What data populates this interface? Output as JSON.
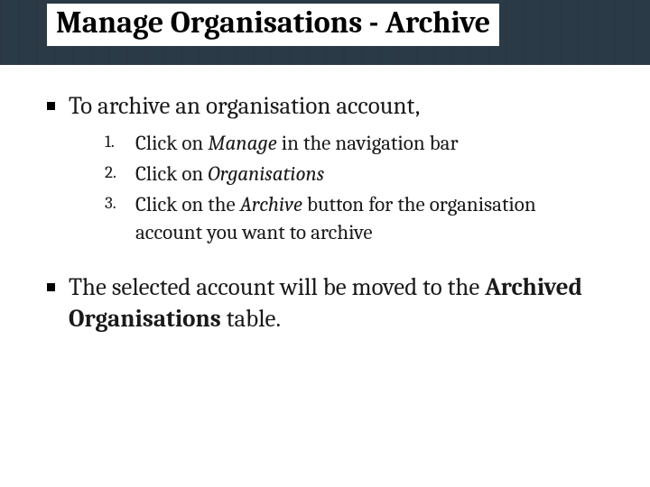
{
  "title": "Manage Organisations - Archive",
  "bullets": {
    "intro": "To archive an organisation account,",
    "steps": [
      {
        "pre": "Click on ",
        "em": "Manage",
        "post": " in the navigation bar"
      },
      {
        "pre": "Click on ",
        "em": "Organisations",
        "post": ""
      },
      {
        "pre": "Click on the ",
        "em": "Archive",
        "post": " button for the organisation account you want to archive"
      }
    ],
    "outro_pre": "The selected account will be moved to the ",
    "outro_bold": "Archived Organisations",
    "outro_post": " table."
  }
}
